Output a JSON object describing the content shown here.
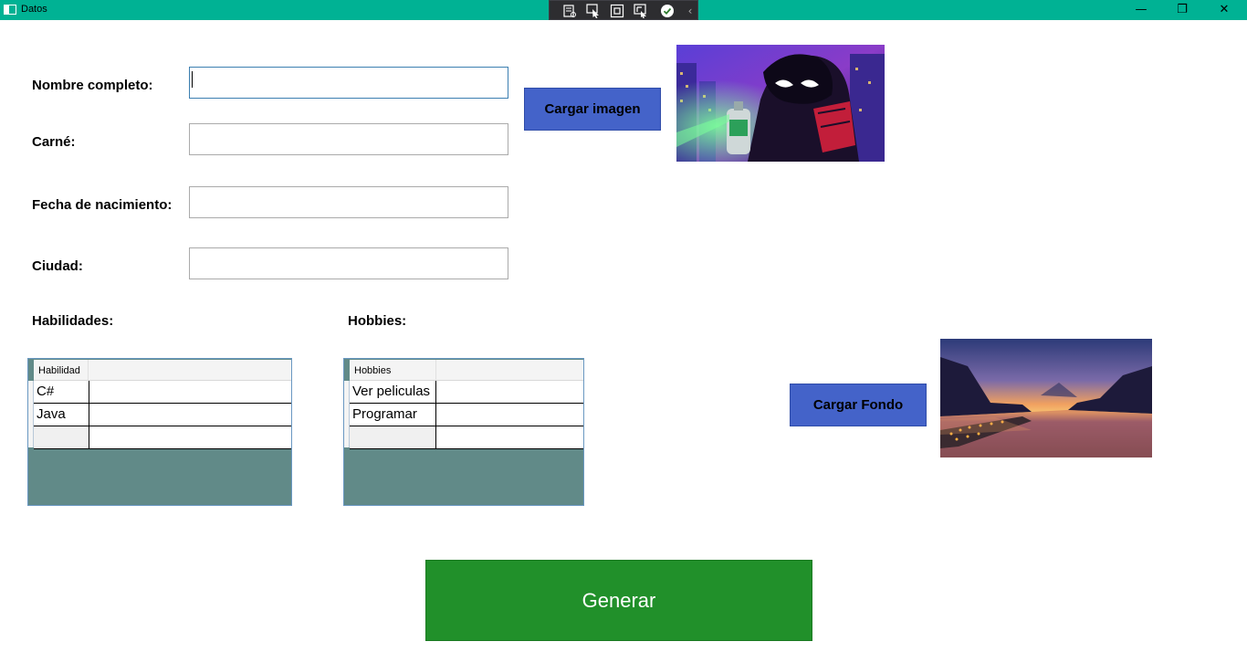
{
  "window": {
    "title": "Datos",
    "minimize_glyph": "—",
    "restore_glyph": "❐",
    "close_glyph": "✕"
  },
  "debug_toolbar": {
    "icons": [
      "live-visual-tree-icon",
      "select-element-icon",
      "display-layout-adorners-icon",
      "track-focus-icon",
      "hot-reload-check-icon",
      "collapse-chevron-icon"
    ],
    "collapse_glyph": "‹"
  },
  "form": {
    "nombre_label": "Nombre completo:",
    "nombre_value": "",
    "carne_label": "Carné:",
    "carne_value": "",
    "fecha_label": "Fecha de nacimiento:",
    "fecha_value": "",
    "ciudad_label": "Ciudad:",
    "ciudad_value": ""
  },
  "buttons": {
    "cargar_imagen": "Cargar imagen",
    "cargar_fondo": "Cargar Fondo",
    "generar": "Generar"
  },
  "habilidades": {
    "title": "Habilidades:",
    "columns": [
      "Habilidad",
      ""
    ],
    "rows": [
      [
        "C#",
        ""
      ],
      [
        "Java",
        ""
      ],
      [
        "",
        ""
      ]
    ]
  },
  "hobbies": {
    "title": "Hobbies:",
    "columns": [
      "Hobbies",
      ""
    ],
    "rows": [
      [
        "Ver peliculas",
        ""
      ],
      [
        "Programar",
        ""
      ],
      [
        "",
        ""
      ]
    ]
  },
  "colors": {
    "titlebar": "#00b294",
    "button_blue": "#4463c9",
    "button_green": "#21902a",
    "grid_background": "#618a88"
  }
}
